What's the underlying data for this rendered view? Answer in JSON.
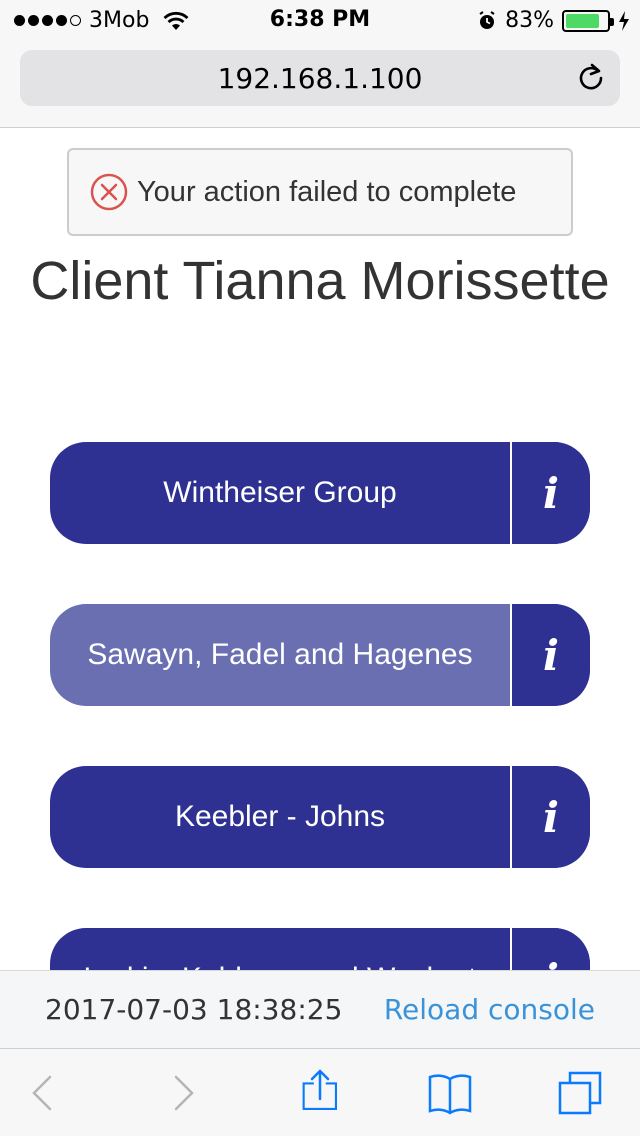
{
  "status_bar": {
    "carrier": "3Mob",
    "time": "6:38 PM",
    "battery_percent": "83%",
    "battery_level": 0.83,
    "signal_bars": 4,
    "signal_max": 5,
    "icons": [
      "signal-dots-icon",
      "wifi-icon",
      "alarm-icon",
      "battery-icon",
      "charging-icon"
    ]
  },
  "browser": {
    "url": "192.168.1.100",
    "reload_icon": "reload-icon"
  },
  "alert": {
    "message": "Your action failed to complete",
    "icon": "error-circle-icon",
    "color": "#d9534f"
  },
  "page": {
    "title": "Client Tianna Morissette"
  },
  "companies": [
    {
      "name": "Wintheiser Group",
      "active": false
    },
    {
      "name": "Sawayn, Fadel and Hagenes",
      "active": true
    },
    {
      "name": "Keebler - Johns",
      "active": false
    },
    {
      "name": "Larkin, Kuhlman and Wuckert",
      "active": false
    }
  ],
  "footer": {
    "timestamp": "2017-07-03 18:38:25",
    "reload_label": "Reload console"
  },
  "toolbar": {
    "icons": [
      "back-icon",
      "forward-icon",
      "share-icon",
      "bookmarks-icon",
      "tabs-icon"
    ]
  },
  "colors": {
    "primary": "#2e3192",
    "active": "#6a6fb2",
    "link": "#3a93d8",
    "ios_blue": "#0a7aff"
  }
}
